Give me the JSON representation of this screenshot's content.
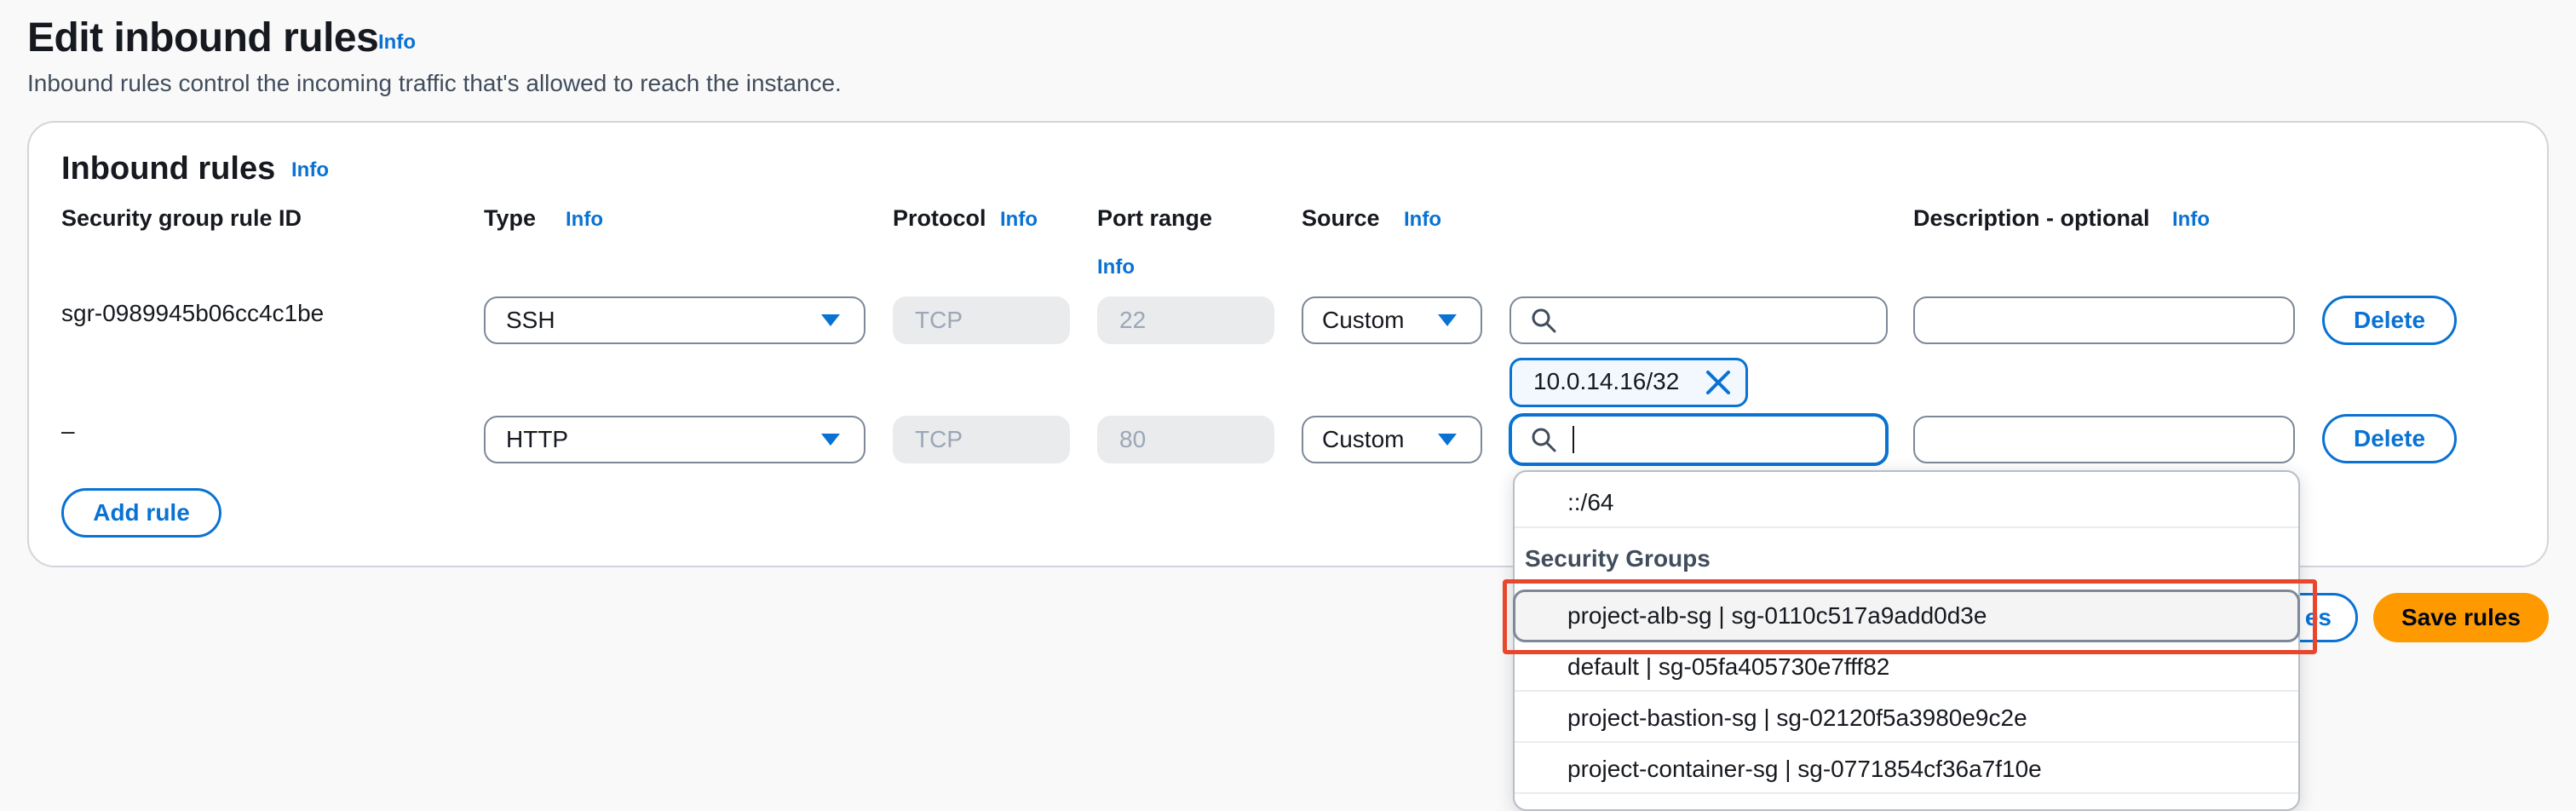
{
  "header": {
    "title": "Edit inbound rules",
    "info": "Info",
    "description": "Inbound rules control the incoming traffic that's allowed to reach the instance."
  },
  "panel": {
    "title": "Inbound rules",
    "info": "Info",
    "columns": {
      "rule_id": "Security group rule ID",
      "type": "Type",
      "protocol": "Protocol",
      "port_range": "Port range",
      "source": "Source",
      "description": "Description - optional",
      "info": "Info"
    },
    "rows": [
      {
        "rule_id": "sgr-0989945b06cc4c1be",
        "type": "SSH",
        "protocol": "TCP",
        "port": "22",
        "source": "Custom",
        "search_value": "",
        "token": "10.0.14.16/32",
        "description": "",
        "delete_label": "Delete"
      },
      {
        "rule_id": "–",
        "type": "HTTP",
        "protocol": "TCP",
        "port": "80",
        "source": "Custom",
        "search_value": "",
        "description": "",
        "delete_label": "Delete"
      }
    ],
    "add_rule_label": "Add rule"
  },
  "footer": {
    "partial_button": "es",
    "save_label": "Save rules"
  },
  "dropdown": {
    "top_item": "::/64",
    "group_label": "Security Groups",
    "options": [
      "project-alb-sg | sg-0110c517a9add0d3e",
      "default | sg-05fa405730e7fff82",
      "project-bastion-sg | sg-02120f5a3980e9c2e",
      "project-container-sg | sg-0771854cf36a7f10e"
    ]
  },
  "colors": {
    "accent": "#0972d3",
    "primary_button": "#ff9900",
    "highlight_border": "#e8472d"
  }
}
